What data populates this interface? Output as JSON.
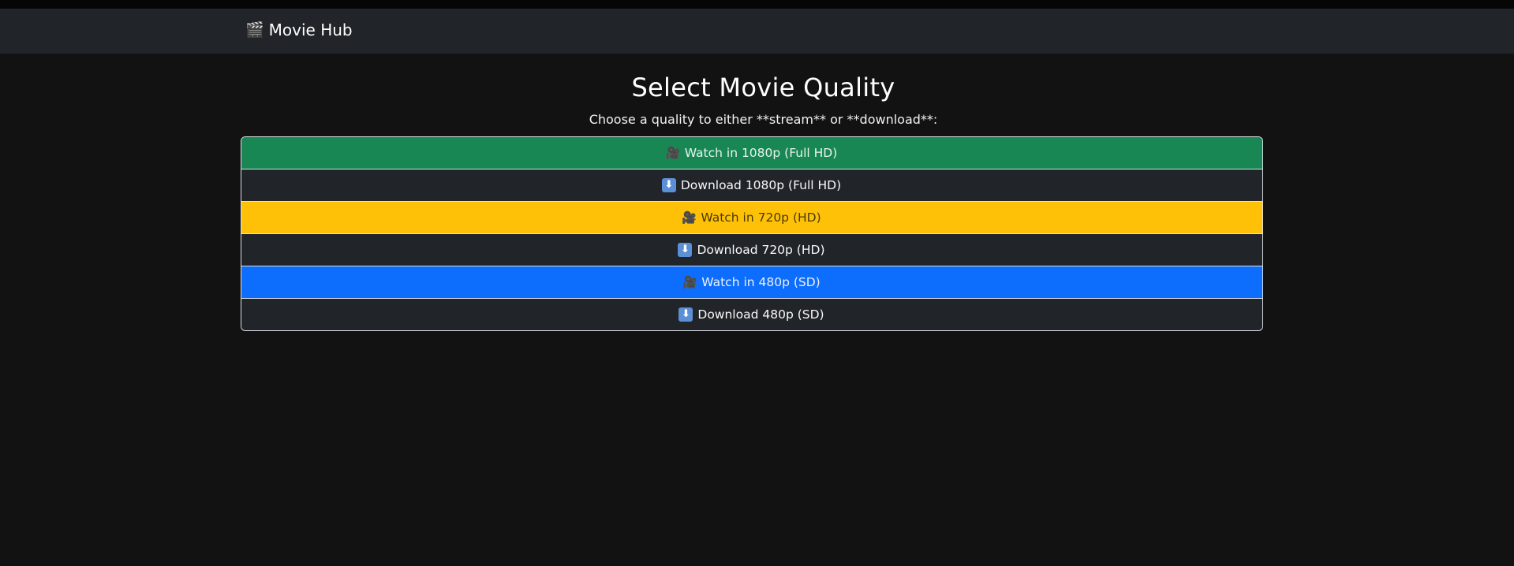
{
  "navbar": {
    "brand_icon": "🎬",
    "brand_text": "Movie Hub"
  },
  "main": {
    "title": "Select Movie Quality",
    "subtitle": "Choose a quality to either **stream** or **download**:"
  },
  "options": [
    {
      "icon": "video-camera-icon",
      "glyph": "🎥",
      "label": "Watch in 1080p (Full HD)",
      "color": "#198754"
    },
    {
      "icon": "download-arrow-icon",
      "glyph": "⬇",
      "label": "Download 1080p (Full HD)",
      "color": "#212529"
    },
    {
      "icon": "video-camera-icon",
      "glyph": "🎥",
      "label": "Watch in 720p (HD)",
      "color": "#ffc107"
    },
    {
      "icon": "download-arrow-icon",
      "glyph": "⬇",
      "label": "Download 720p (HD)",
      "color": "#212529"
    },
    {
      "icon": "video-camera-icon",
      "glyph": "🎥",
      "label": "Watch in 480p (SD)",
      "color": "#0d6efd"
    },
    {
      "icon": "download-arrow-icon",
      "glyph": "⬇",
      "label": "Download 480p (SD)",
      "color": "#212529"
    }
  ]
}
